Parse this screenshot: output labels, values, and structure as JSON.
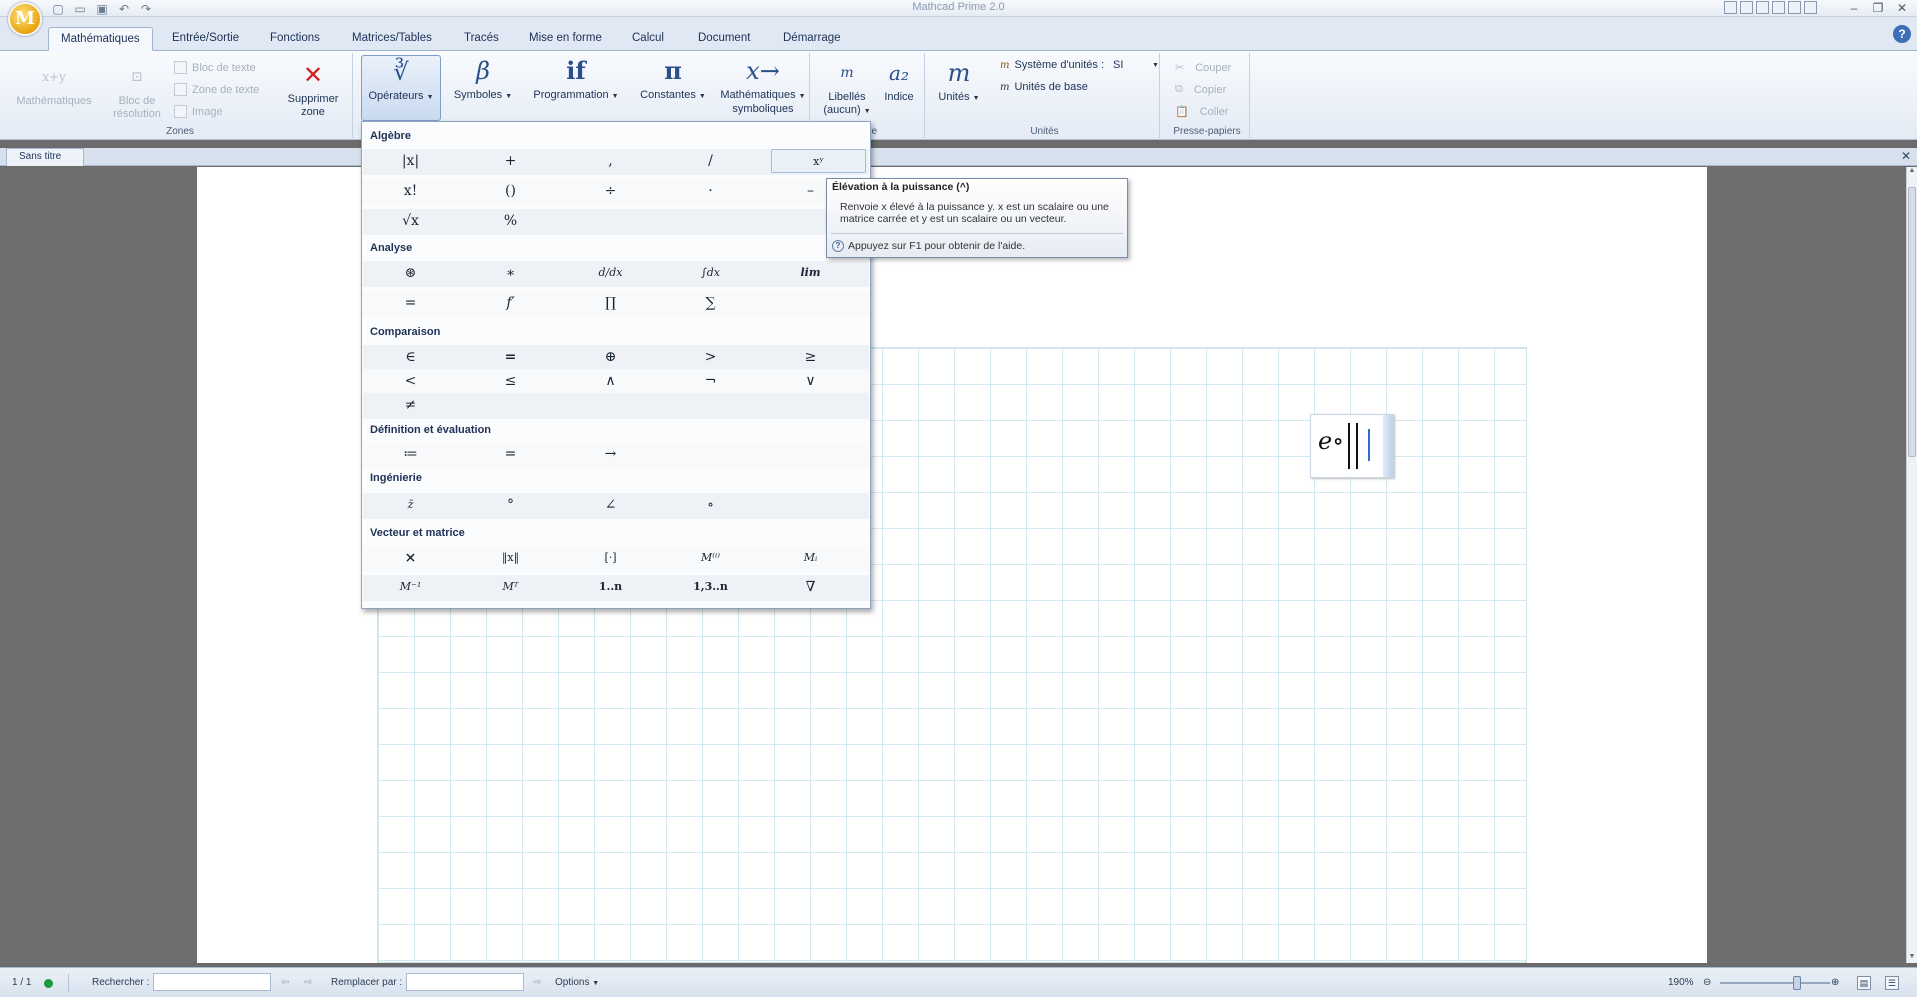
{
  "window": {
    "title": "Mathcad Prime 2.0"
  },
  "app_logo": "M",
  "quick_access": [
    "new-file-icon",
    "open-folder-icon",
    "save-icon",
    "undo-icon",
    "redo-icon"
  ],
  "ribbon_tabs": [
    {
      "label": "Mathématiques",
      "active": true
    },
    {
      "label": "Entrée/Sortie"
    },
    {
      "label": "Fonctions"
    },
    {
      "label": "Matrices/Tables"
    },
    {
      "label": "Tracés"
    },
    {
      "label": "Mise en forme"
    },
    {
      "label": "Calcul"
    },
    {
      "label": "Document"
    },
    {
      "label": "Démarrage"
    }
  ],
  "zones_group": {
    "label": "Zones",
    "math_btn": "Mathématiques",
    "solve_btn_l1": "Bloc de",
    "solve_btn_l2": "résolution",
    "text_block": "Bloc de texte",
    "text_zone": "Zone de texte",
    "image": "Image",
    "delete_l1": "Supprimer",
    "delete_l2": "zone"
  },
  "math_group": {
    "operators": "Opérateurs",
    "operators_icon": "∛",
    "symbols": "Symboles",
    "symbols_icon": "β",
    "programming": "Programmation",
    "programming_icon": "if",
    "constants": "Constantes",
    "constants_icon": "π",
    "symbolic_l1": "Mathématiques",
    "symbolic_l2": "symboliques",
    "symbolic_icon": "x→"
  },
  "style_group": {
    "labels_l1": "Libellés",
    "labels_l2": "(aucun)",
    "labels_icon": "m",
    "index": "Indice",
    "index_icon": "a₂",
    "label_fragment": "lle"
  },
  "units_group": {
    "label": "Unités",
    "units_btn": "Unités",
    "units_icon": "m",
    "unit_system": "Système d'unités :",
    "unit_system_value": "SI",
    "base_units": "Unités de base"
  },
  "clipboard_group": {
    "label": "Presse-papiers",
    "cut": "Couper",
    "copy": "Copier",
    "paste": "Coller"
  },
  "document_tab": "Sans titre",
  "operators_menu": {
    "algebra": {
      "title": "Algèbre",
      "row1": [
        "|x|",
        "+",
        ",",
        "/",
        "xʸ"
      ],
      "row2": [
        "x!",
        "()",
        "÷",
        "·",
        "–"
      ],
      "row3": [
        "√x",
        "%"
      ]
    },
    "analysis": {
      "title": "Analyse",
      "row1": [
        "⊛",
        "∗",
        "d/dx",
        "∫dx",
        "lim"
      ],
      "row2": [
        "=",
        "f′",
        "∏",
        "∑"
      ]
    },
    "comparison": {
      "title": "Comparaison",
      "row1": [
        "∈",
        "=",
        "⊕",
        ">",
        "≥"
      ],
      "row2": [
        "<",
        "≤",
        "∧",
        "¬",
        "∨"
      ],
      "row3": [
        "≠"
      ]
    },
    "definition": {
      "title": "Définition et évaluation",
      "row1": [
        "≔",
        "=",
        "→"
      ]
    },
    "engineering": {
      "title": "Ingénierie",
      "row1": [
        "z̄",
        "°",
        "∠",
        "∘"
      ]
    },
    "vector": {
      "title": "Vecteur et matrice",
      "row1": [
        "×",
        "‖x‖",
        "[·]",
        "M⁽ⁱ⁾",
        "Mᵢ"
      ],
      "row2": [
        "M⁻¹",
        "Mᵀ",
        "1..n",
        "1,3..n",
        "∇"
      ]
    }
  },
  "tooltip": {
    "title": "Élévation à la puissance (^)",
    "body": "Renvoie x élevé à la puissance y. x est un scalaire ou une matrice carrée et y est un scalaire ou un vecteur.",
    "help": "Appuyez sur F1 pour obtenir de l'aide."
  },
  "math_region": {
    "expression": "e∘"
  },
  "status": {
    "page": "1 / 1",
    "search_label": "Rechercher :",
    "replace_label": "Remplacer par :",
    "options": "Options",
    "zoom": "190%",
    "zoom_level": 0.72
  }
}
